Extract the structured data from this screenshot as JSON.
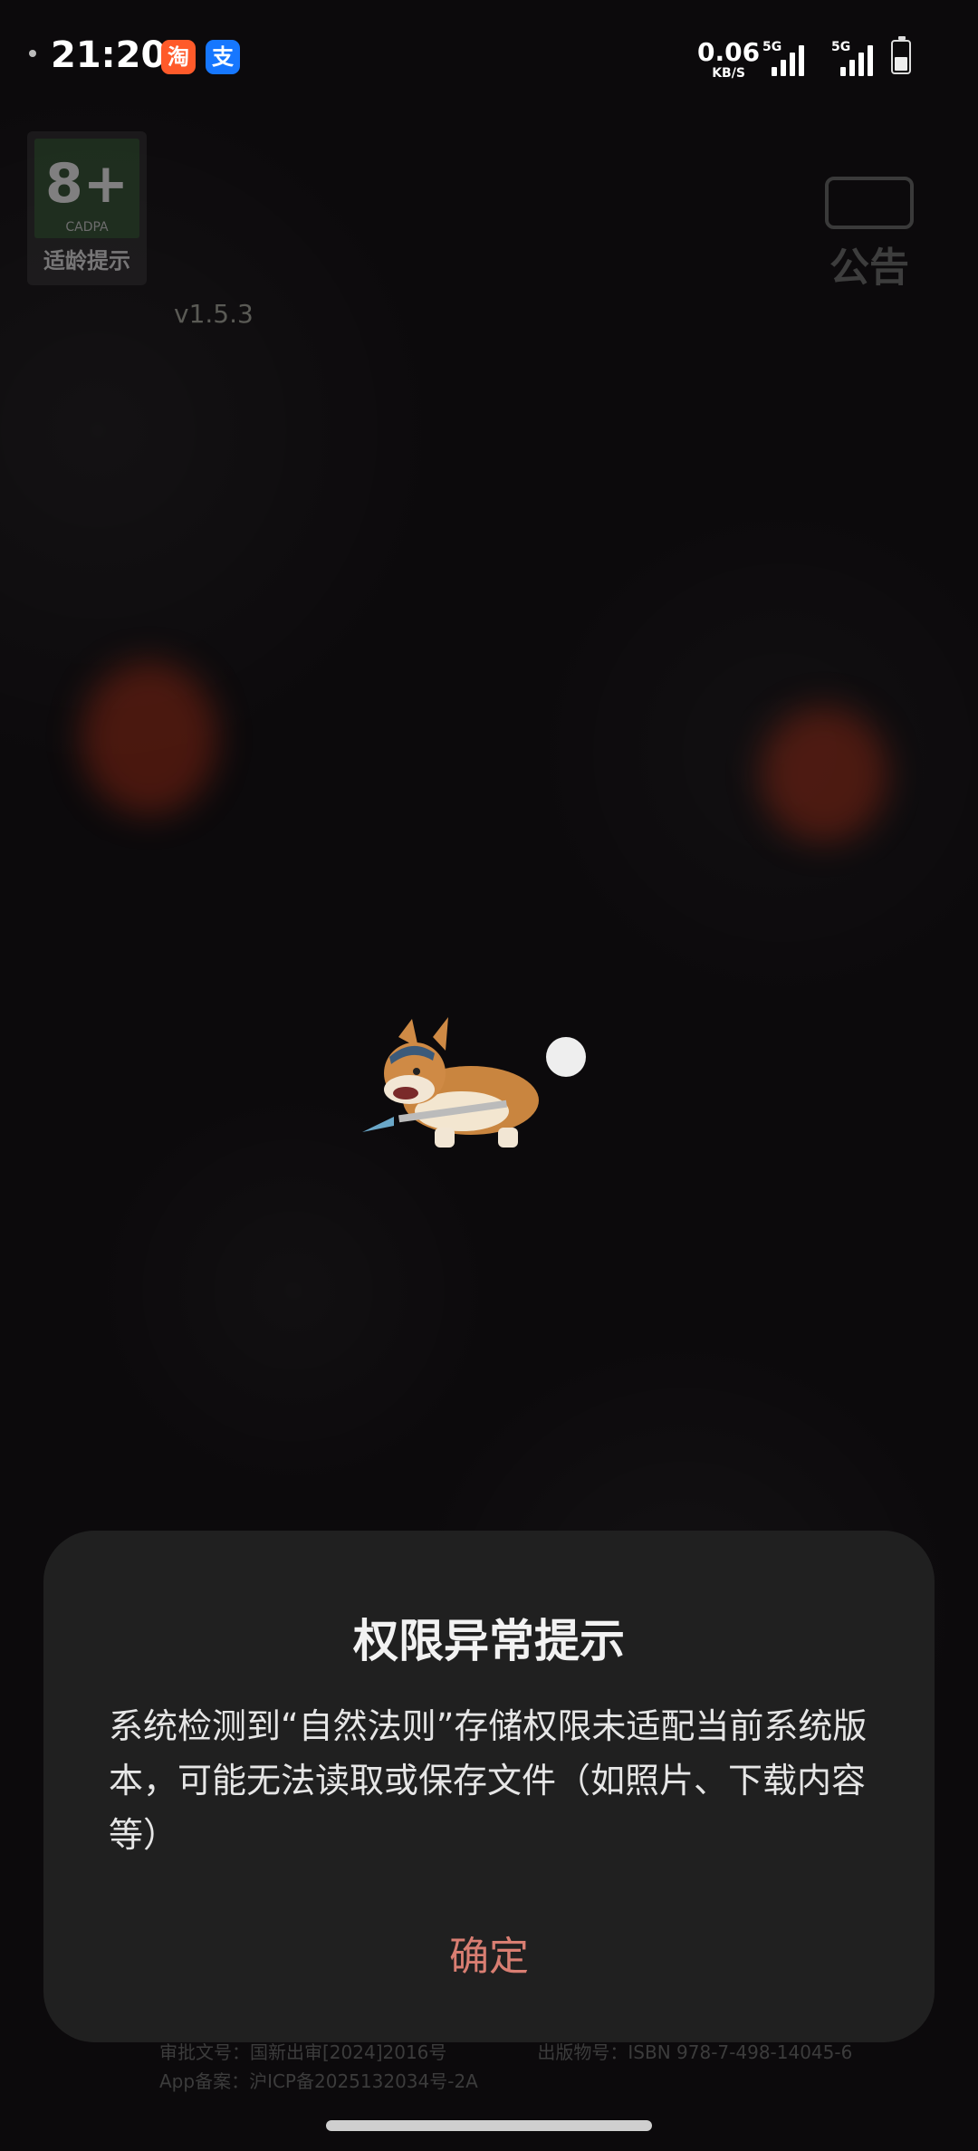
{
  "status_bar": {
    "time": "21:20",
    "apps": [
      "淘",
      "支"
    ],
    "network_speed": "0.06",
    "network_unit": "KB/S",
    "signal1_label": "5G",
    "signal2_label": "5G"
  },
  "game": {
    "age_rating": "8+",
    "age_org": "CADPA",
    "age_label": "适龄提示",
    "version": "v1.5.3",
    "notice_label": "公告"
  },
  "footer": {
    "approval": "审批文号：国新出审[2024]2016号",
    "isbn": "出版物号：ISBN 978-7-498-14045-6",
    "app_record": "App备案：沪ICP备2025132034号-2A"
  },
  "dialog": {
    "title": "权限异常提示",
    "message": "系统检测到“自然法则”存储权限未适配当前系统版本，可能无法读取或保存文件（如照片、下载内容等）",
    "confirm_label": "确定"
  },
  "colors": {
    "accent": "#d97e72",
    "dialog_bg": "#202020"
  }
}
